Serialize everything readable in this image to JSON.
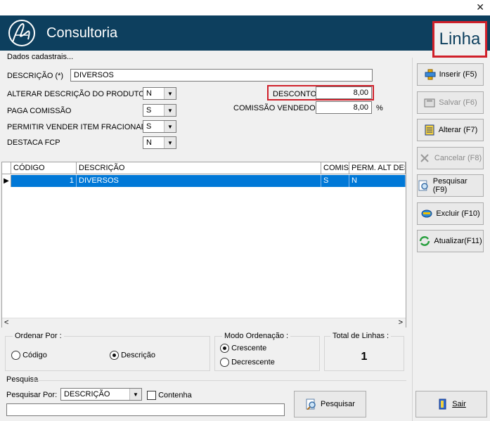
{
  "window": {
    "close_glyph": "✕"
  },
  "header": {
    "app_title": "Consultoria",
    "screen_title": "Linha"
  },
  "form": {
    "section_label": "Dados cadastrais...",
    "descricao_label": "DESCRIÇÃO (*)",
    "descricao_value": "DIVERSOS",
    "alterar_label": "ALTERAR DESCRIÇÃO DO PRODUTO",
    "alterar_value": "N",
    "paga_label": "PAGA COMISSÃO",
    "paga_value": "S",
    "fracionado_label": "PERMITIR VENDER ITEM FRACIONADO",
    "fracionado_value": "S",
    "fcp_label": "DESTACA FCP",
    "fcp_value": "N",
    "desconto_label": "DESCONTO",
    "desconto_value": "8,00",
    "comissao_label": "COMISSÃO VENDEDOR",
    "comissao_value": "8,00",
    "percent": "%"
  },
  "grid": {
    "columns": [
      "CÓDIGO",
      "DESCRIÇÃO",
      "COMIS",
      "PERM. ALT DESC"
    ],
    "row": {
      "codigo": "1",
      "descricao": "DIVERSOS",
      "comis": "S",
      "perm": "N"
    },
    "scroll_left": "<",
    "scroll_right": ">"
  },
  "ordenar": {
    "title": "Ordenar Por :",
    "opt_codigo": "Código",
    "opt_descricao": "Descrição",
    "selected": "Descrição"
  },
  "modo": {
    "title": "Modo Ordenação :",
    "opt_cres": "Crescente",
    "opt_decres": "Decrescente",
    "selected": "Crescente"
  },
  "total": {
    "title": "Total de Linhas :",
    "value": "1"
  },
  "pesquisa": {
    "title": "Pesquisa",
    "por_label": "Pesquisar Por:",
    "por_value": "DESCRIÇÃO",
    "contenha_label": "Contenha",
    "search_value": "",
    "button_label": "Pesquisar"
  },
  "sidebar": {
    "inserir": "Inserir (F5)",
    "salvar": "Salvar (F6)",
    "alterar": "Alterar (F7)",
    "cancelar": "Cancelar (F8)",
    "pesquisar": "Pesquisar (F9)",
    "excluir": "Excluir (F10)",
    "atualizar": "Atualizar(F11)",
    "sair": "Sair"
  },
  "colors": {
    "header": "#0d3f5e",
    "highlight": "#d0202a",
    "selection": "#0078d7"
  }
}
